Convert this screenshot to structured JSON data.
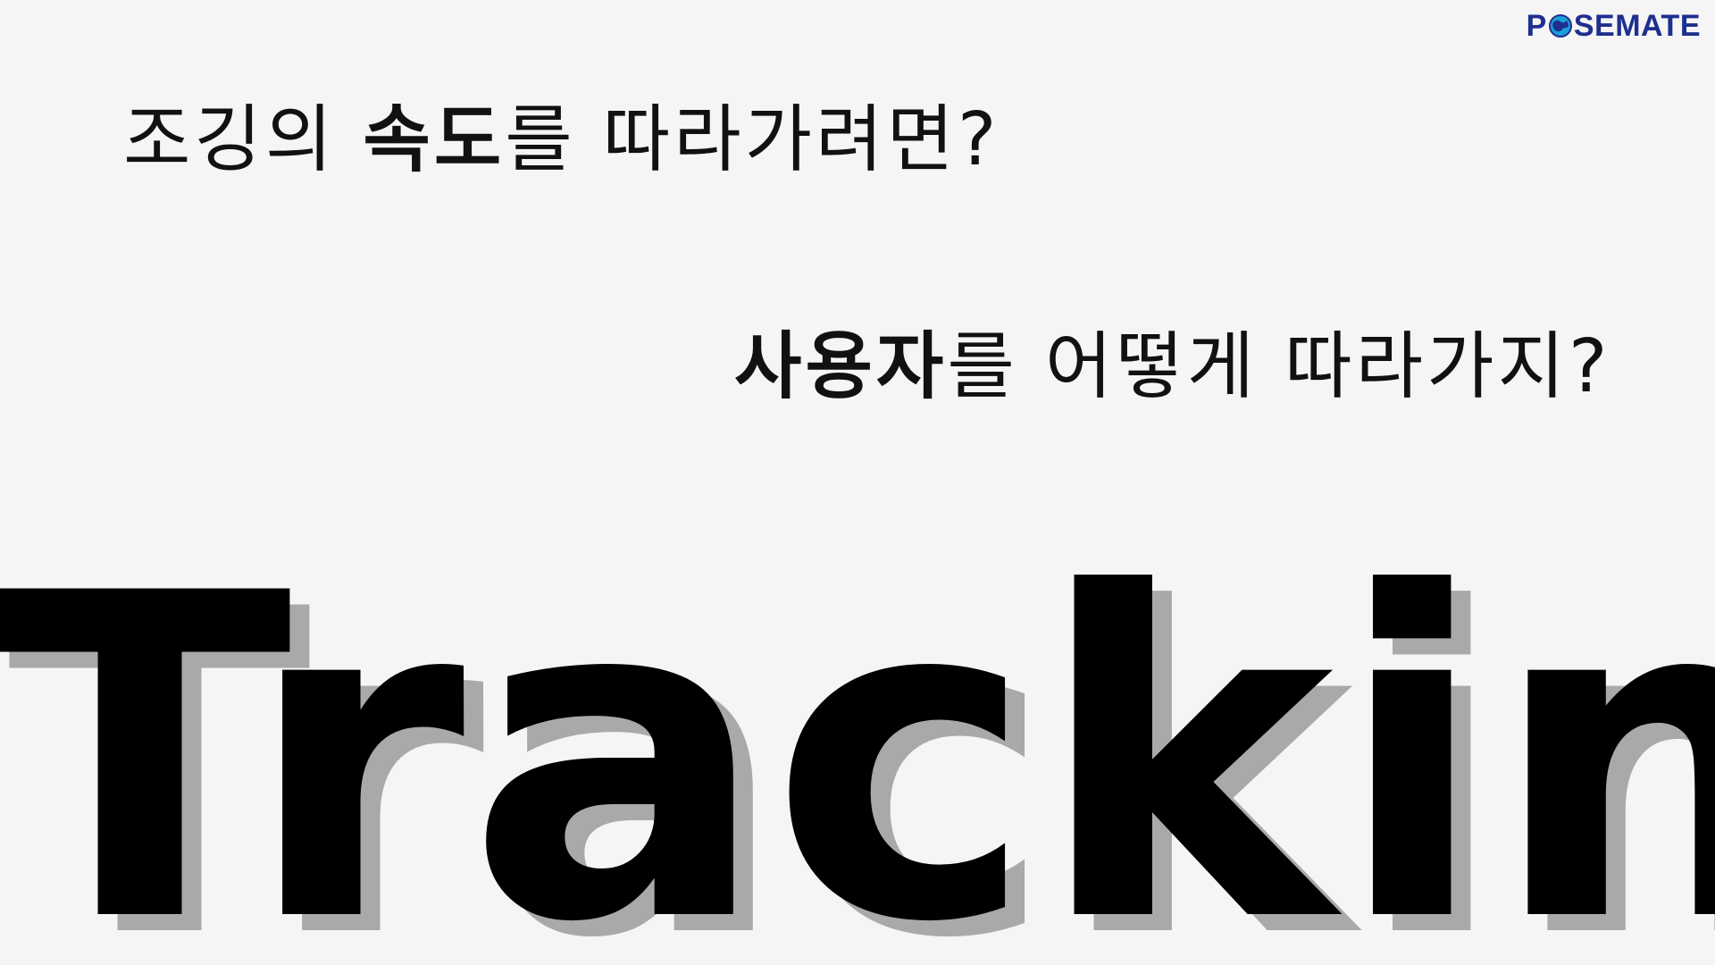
{
  "logo": {
    "prefix": "P",
    "icon": "globe-icon",
    "suffix": "SEMATE",
    "color": "#1f2f8f",
    "icon_color": "#1aa0d8"
  },
  "question1": {
    "part1": "조깅의 ",
    "bold": "속도",
    "part2": "를 따라가려면?"
  },
  "question2": {
    "bold": "사용자",
    "part2": "를 어떻게 따라가지?"
  },
  "headline": "Tracking",
  "colors": {
    "background": "#f5f5f5",
    "text": "#111111",
    "shadow": "#a9a9a9"
  }
}
